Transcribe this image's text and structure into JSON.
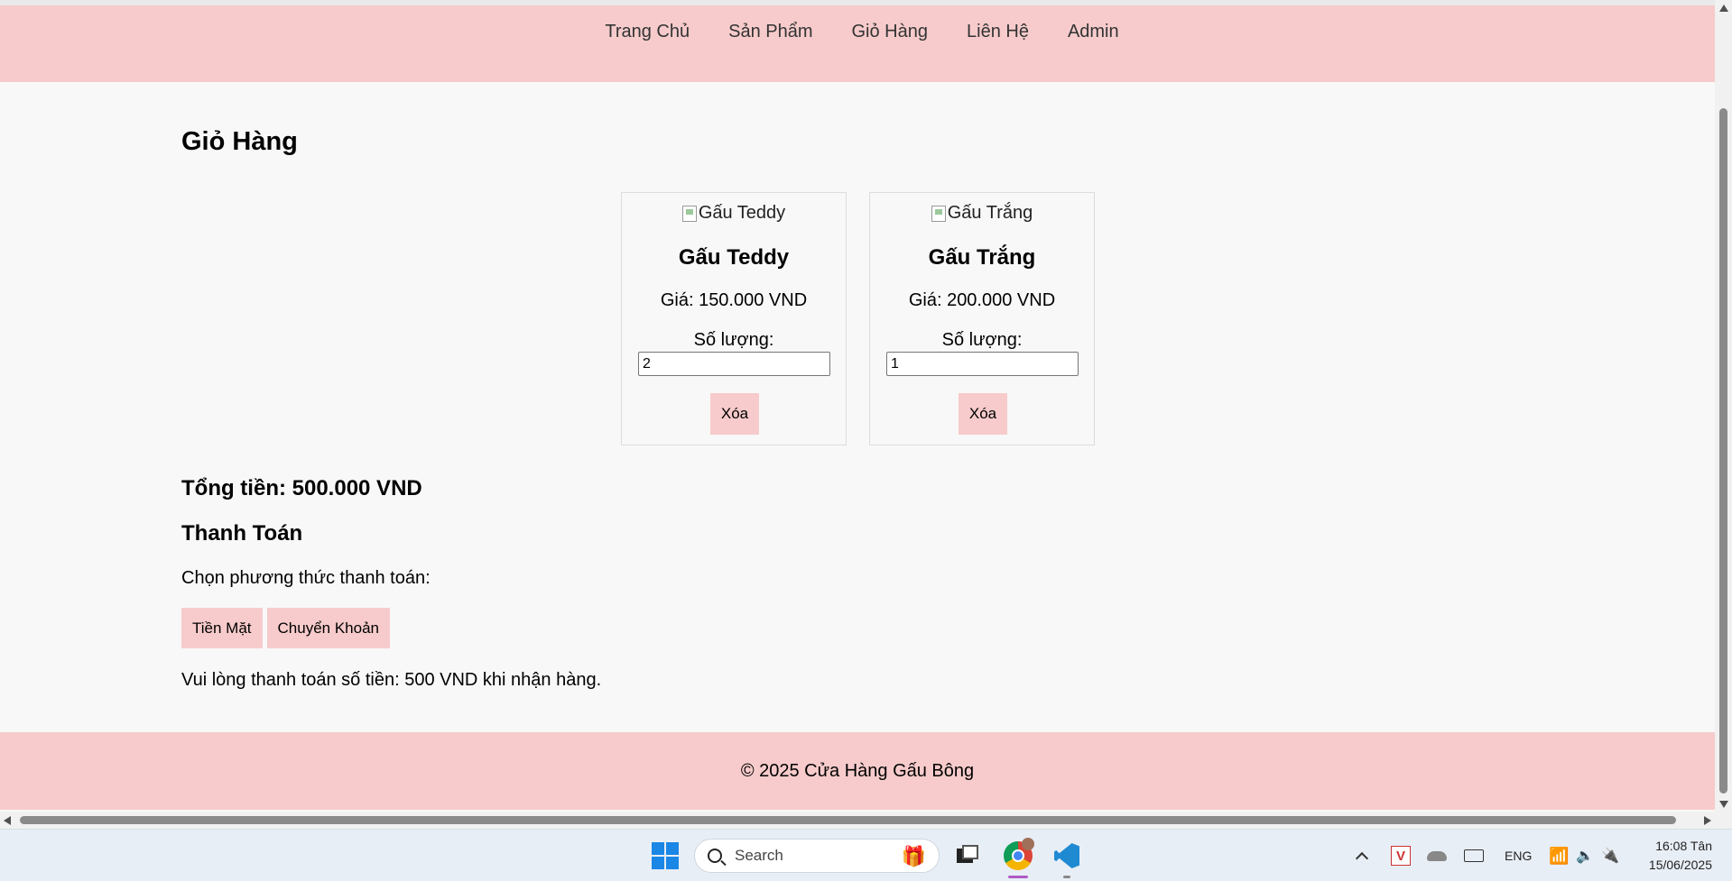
{
  "nav": {
    "items": [
      "Trang Chủ",
      "Sản Phẩm",
      "Giỏ Hàng",
      "Liên Hệ",
      "Admin"
    ]
  },
  "page": {
    "title": "Giỏ Hàng"
  },
  "cart": {
    "items": [
      {
        "image_alt": "Gấu Teddy",
        "name": "Gấu Teddy",
        "price": "Giá: 150.000 VND",
        "qty_label": "Số lượng:",
        "qty": "2",
        "delete_label": "Xóa"
      },
      {
        "image_alt": "Gấu Trắng",
        "name": "Gấu Trắng",
        "price": "Giá: 200.000 VND",
        "qty_label": "Số lượng:",
        "qty": "1",
        "delete_label": "Xóa"
      }
    ],
    "total": "Tổng tiền: 500.000 VND"
  },
  "payment": {
    "title": "Thanh Toán",
    "choose_label": "Chọn phương thức thanh toán:",
    "cash_label": "Tiền Mặt",
    "transfer_label": "Chuyển Khoản",
    "note": "Vui lòng thanh toán số tiền: 500 VND khi nhận hàng."
  },
  "footer": {
    "text": "© 2025 Cửa Hàng Gấu Bông"
  },
  "taskbar": {
    "search_placeholder": "Search",
    "lang": "ENG",
    "time": "16:08 Tân",
    "date": "15/06/2025",
    "tray_v_label": "V",
    "gift_glyph": "🎁",
    "net_glyph": "📶",
    "volume_glyph": "🔈",
    "battery_glyph": "🔌"
  },
  "colors": {
    "accent_pink": "#f7cbcb",
    "page_bg": "#f8f8f8",
    "windows_blue": "#1a86e6"
  }
}
